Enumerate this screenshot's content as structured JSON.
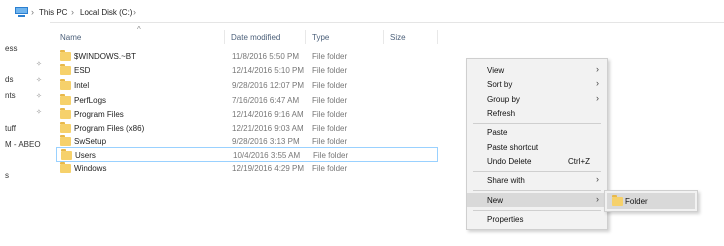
{
  "address_bar": {
    "separator": "›",
    "crumbs": [
      "This PC",
      "Local Disk (C:)"
    ],
    "icon": "this-pc-icon"
  },
  "nav_pane": {
    "items": [
      "ess",
      "ds",
      "nts",
      "tuff",
      "M - ABEO",
      "s"
    ],
    "pin_glyph": "✧"
  },
  "columns": {
    "name": "Name",
    "date_modified": "Date modified",
    "type": "Type",
    "size": "Size",
    "sort_arrow": "^"
  },
  "files": [
    {
      "name": "$WINDOWS.~BT",
      "date": "11/8/2016 5:50 PM",
      "type": "File folder"
    },
    {
      "name": "ESD",
      "date": "12/14/2016 5:10 PM",
      "type": "File folder"
    },
    {
      "name": "Intel",
      "date": "9/28/2016 12:07 PM",
      "type": "File folder"
    },
    {
      "name": "PerfLogs",
      "date": "7/16/2016 6:47 AM",
      "type": "File folder"
    },
    {
      "name": "Program Files",
      "date": "12/14/2016 9:16 AM",
      "type": "File folder"
    },
    {
      "name": "Program Files (x86)",
      "date": "12/21/2016 9:03 AM",
      "type": "File folder"
    },
    {
      "name": "SwSetup",
      "date": "9/28/2016 3:13 PM",
      "type": "File folder"
    },
    {
      "name": "Users",
      "date": "10/4/2016 3:55 AM",
      "type": "File folder",
      "selected": true
    },
    {
      "name": "Windows",
      "date": "12/19/2016 4:29 PM",
      "type": "File folder"
    }
  ],
  "context_menu": {
    "view": "View",
    "sort_by": "Sort by",
    "group_by": "Group by",
    "refresh": "Refresh",
    "paste": "Paste",
    "paste_shortcut": "Paste shortcut",
    "undo_delete": "Undo Delete",
    "undo_delete_shortcut": "Ctrl+Z",
    "share_with": "Share with",
    "new": "New",
    "properties": "Properties",
    "arrow": "›"
  },
  "submenu": {
    "folder": "Folder"
  },
  "colors": {
    "selection_border": "#99d1ff",
    "menu_background": "#f2f2f2",
    "menu_hover": "#d9d9d9",
    "folder_yellow": "#f6d16b"
  }
}
